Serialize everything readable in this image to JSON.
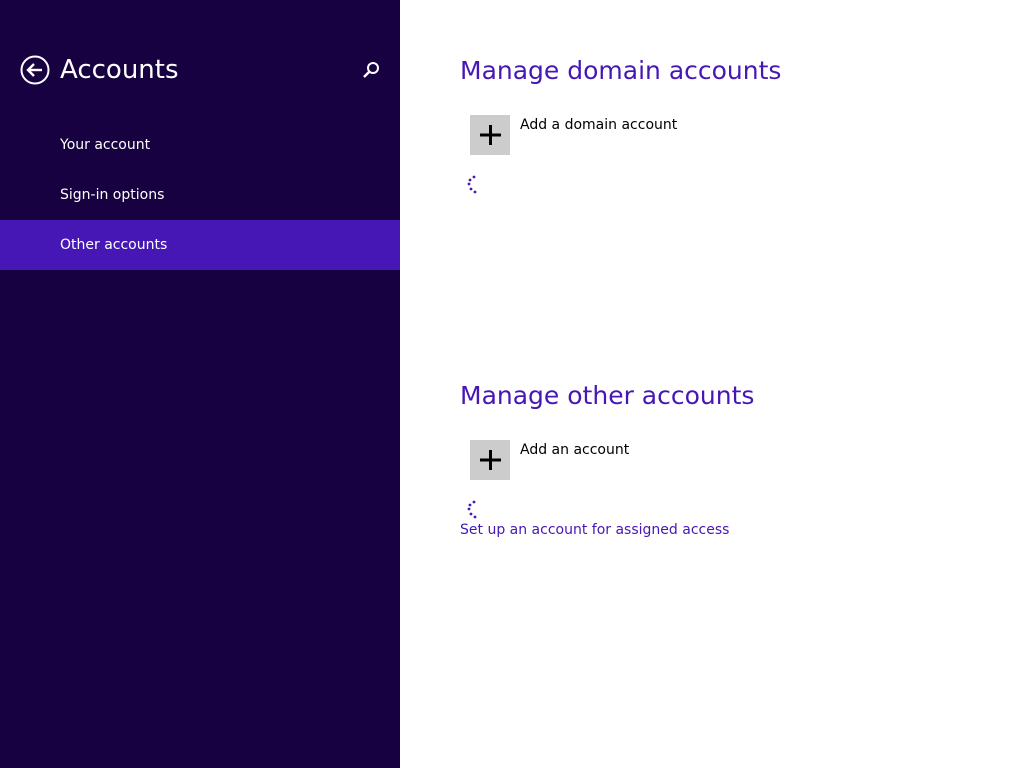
{
  "colors": {
    "sidebar_bg": "#180140",
    "accent": "#4617b4",
    "plus_box": "#cccccc"
  },
  "sidebar": {
    "back_icon": "back-arrow-circle-icon",
    "title": "Accounts",
    "search_icon": "search-icon",
    "items": [
      {
        "label": "Your account",
        "selected": false
      },
      {
        "label": "Sign-in options",
        "selected": false
      },
      {
        "label": "Other accounts",
        "selected": true
      }
    ]
  },
  "main": {
    "domain_section": {
      "title": "Manage domain accounts",
      "add_label": "Add a domain account",
      "add_icon": "plus-icon",
      "loading": true
    },
    "other_section": {
      "title": "Manage other accounts",
      "add_label": "Add an account",
      "add_icon": "plus-icon",
      "loading": true
    },
    "assigned_access_link": "Set up an account for assigned access"
  }
}
